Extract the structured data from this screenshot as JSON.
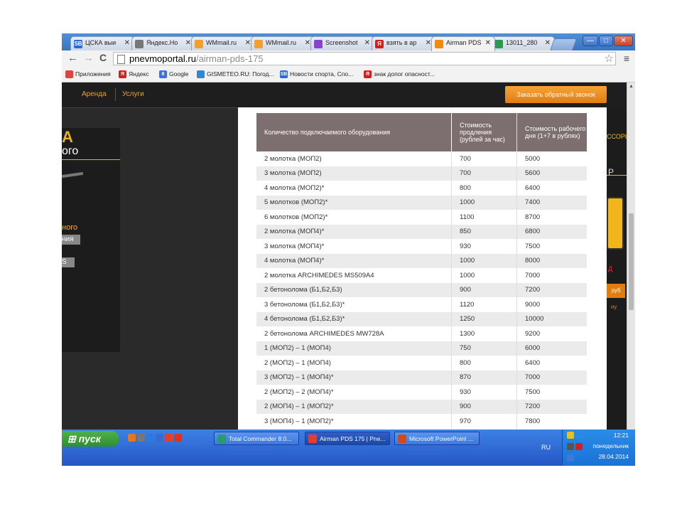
{
  "tabs": [
    {
      "label": "ЦСКА выи",
      "icon": "sb-icon",
      "color": "#2a6ad8",
      "glyph": "SB"
    },
    {
      "label": "Яндекс.Но",
      "icon": "page-icon",
      "color": "#777777",
      "glyph": ""
    },
    {
      "label": "WMmail.ru",
      "icon": "wmmail-icon",
      "color": "#f0a030",
      "glyph": ""
    },
    {
      "label": "WMmail.ru",
      "icon": "wmmail-icon",
      "color": "#f0a030",
      "glyph": ""
    },
    {
      "label": "Screenshot",
      "icon": "feather-icon",
      "color": "#8844cc",
      "glyph": ""
    },
    {
      "label": "взять в ар",
      "icon": "yandex-icon",
      "color": "#d02020",
      "glyph": "Я"
    },
    {
      "label": "Airman PDS",
      "icon": "airman-icon",
      "color": "#f08a10",
      "glyph": ""
    },
    {
      "label": "13011_280",
      "icon": "image-icon",
      "color": "#2a9a50",
      "glyph": ""
    }
  ],
  "window_buttons": {
    "minimize": "—",
    "maximize": "□",
    "close": "✕"
  },
  "toolbar": {
    "back": "←",
    "forward": "→",
    "reload": "C",
    "star": "☆",
    "menu": "≡"
  },
  "address": {
    "host": "pnevmoportal.ru",
    "path": "/airman-pds-175"
  },
  "bookmarks": [
    {
      "label": "Приложения",
      "icon": "apps-icon",
      "color": "#d44",
      "glyph": ""
    },
    {
      "label": "Яндекс",
      "icon": "yandex-icon",
      "color": "#d02020",
      "glyph": "Я"
    },
    {
      "label": "Google",
      "icon": "google-icon",
      "color": "#3b6fe0",
      "glyph": "8"
    },
    {
      "label": "GISMETEO.RU: Погод...",
      "icon": "gismeteo-icon",
      "color": "#2a88d8",
      "glyph": ""
    },
    {
      "label": "Новости спорта, Спо...",
      "icon": "sb-icon",
      "color": "#2a6ad8",
      "glyph": "SB"
    },
    {
      "label": "знак допог опасност...",
      "icon": "yandex-icon",
      "color": "#d02020",
      "glyph": "Я"
    }
  ],
  "site_nav": {
    "rent": "Аренда",
    "services": "Услуги",
    "callback": "Заказать обратный звонок"
  },
  "left_panel": {
    "a": "А",
    "go": "ого",
    "nogo": "ного",
    "box1": "ния",
    "box2": "S"
  },
  "right_panel": {
    "t1": "ССОРЫ",
    "b": "Р",
    "red": "Д",
    "orange": "руб",
    "o2": "ну"
  },
  "price_table": {
    "headers": [
      "Количество подключаемого оборудования",
      "Стоимость продления (рублей за час)",
      "Стоимость рабочего дня (1+7 в рублях)"
    ],
    "rows": [
      [
        "2 молотка (МОП2)",
        "700",
        "5000"
      ],
      [
        "3 молотка (МОП2)",
        "700",
        "5600"
      ],
      [
        "4 молотка (МОП2)*",
        "800",
        "6400"
      ],
      [
        "5 молотков (МОП2)*",
        "1000",
        "7400"
      ],
      [
        "6 молотков (МОП2)*",
        "1100",
        "8700"
      ],
      [
        "2 молотка (МОП4)*",
        "850",
        "6800"
      ],
      [
        "3 молотка (МОП4)*",
        "930",
        "7500"
      ],
      [
        "4 молотка (МОП4)*",
        "1000",
        "8000"
      ],
      [
        "2 молотка ARCHIMEDES MS509A4",
        "1000",
        "7000"
      ],
      [
        "2 бетонолома (Б1,Б2,Б3)",
        "900",
        "7200"
      ],
      [
        "3 бетонолома (Б1,Б2,Б3)*",
        "1120",
        "9000"
      ],
      [
        "4 бетонолома (Б1,Б2,Б3)*",
        "1250",
        "10000"
      ],
      [
        "2 бетонолома ARCHIMEDES MW728A",
        "1300",
        "9200"
      ],
      [
        "1 (МОП2) – 1 (МОП4)",
        "750",
        "6000"
      ],
      [
        "2 (МОП2) – 1 (МОП4)",
        "800",
        "6400"
      ],
      [
        "3 (МОП2) – 1 (МОП4)*",
        "870",
        "7000"
      ],
      [
        "2 (МОП2) – 2 (МОП4)*",
        "930",
        "7500"
      ],
      [
        "2 (МОП4) – 1 (МОП2)*",
        "900",
        "7200"
      ],
      [
        "3 (МОП4) – 1 (МОП2)*",
        "970",
        "7800"
      ]
    ]
  },
  "taskbar": {
    "start": "пуск",
    "quicklaunch": [
      {
        "icon": "firefox-icon",
        "color": "#e07820"
      },
      {
        "icon": "archive-icon",
        "color": "#777777"
      },
      {
        "icon": "ie-icon",
        "color": "#2a7ae0"
      },
      {
        "icon": "desktop-icon",
        "color": "#3a6ad0"
      },
      {
        "icon": "chrome-icon",
        "color": "#e04030"
      },
      {
        "icon": "yandex-browser-icon",
        "color": "#e03020"
      }
    ],
    "tasks": [
      {
        "label": "Total Commander 8.0...",
        "icon": "totalcmd-icon",
        "color": "#2a9a70"
      },
      {
        "label": "Airman PDS 175 | Pne...",
        "icon": "chrome-icon",
        "color": "#e04030"
      },
      {
        "label": "Microsoft PowerPoint ...",
        "icon": "powerpoint-icon",
        "color": "#d04a20"
      }
    ],
    "lang": "RU",
    "time": "12:21",
    "day": "понедельник",
    "date": "28.04.2014"
  }
}
